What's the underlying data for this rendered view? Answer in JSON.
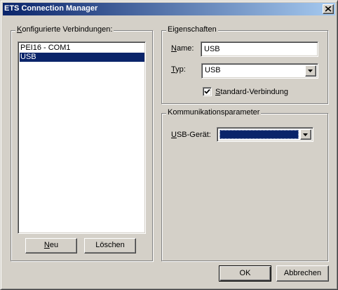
{
  "window": {
    "title": "ETS Connection Manager"
  },
  "connections": {
    "label_prefix": "",
    "label_accel": "K",
    "label_rest": "onfigurierte Verbindungen:",
    "items": [
      "PEI16 - COM1",
      "USB"
    ],
    "selected": "USB",
    "new_button_accel": "N",
    "new_button_rest": "eu",
    "delete_button": "Löschen"
  },
  "properties": {
    "group_label": "Eigenschaften",
    "name_label_accel": "N",
    "name_label_rest": "ame:",
    "name_value": "USB",
    "type_label_accel": "T",
    "type_label_rest": "yp:",
    "type_value": "USB",
    "standard_checked": true,
    "standard_label_accel": "S",
    "standard_label_rest": "tandard-Verbindung"
  },
  "comm": {
    "group_label": "Kommunikationsparameter",
    "usb_label_accel": "U",
    "usb_label_rest": "SB-Gerät:",
    "usb_value": ""
  },
  "footer": {
    "ok": "OK",
    "cancel": "Abbrechen"
  },
  "colors": {
    "titlebar_start": "#0a246a",
    "selection": "#0a246a",
    "face": "#d4d0c8"
  }
}
